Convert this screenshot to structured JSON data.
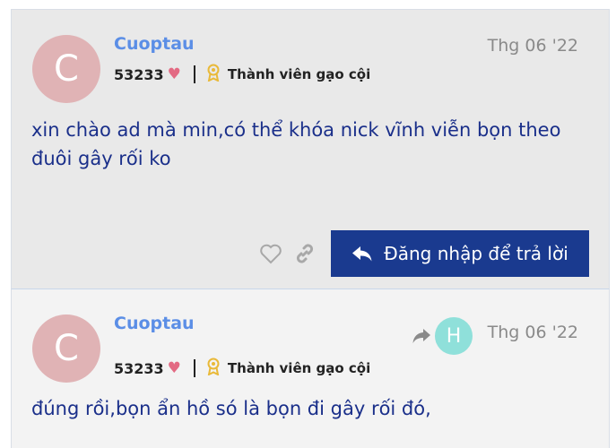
{
  "posts": [
    {
      "avatar_letter": "C",
      "username": "Cuoptau",
      "likes": "53233",
      "user_title": "Thành viên gạo cội",
      "date": "Thg 06 '22",
      "body": "xin chào ad mà min,có thể khóa nick vĩnh viễn bọn theo đuôi gây rối ko",
      "reply_button": "Đăng nhập để trả lời"
    },
    {
      "avatar_letter": "C",
      "username": "Cuoptau",
      "likes": "53233",
      "user_title": "Thành viên gạo cội",
      "date": "Thg 06 '22",
      "reply_to_letter": "H",
      "body": "đúng rồi,bọn ẩn hồ só là bọn đi gây rối đó,"
    }
  ],
  "colors": {
    "accent": "#1a3a8f",
    "username": "#5b8ee6",
    "heart": "#e36a83",
    "badge": "#e9b938",
    "avatar_c": "#e0b3b5",
    "avatar_h": "#8fe0da"
  },
  "icons": [
    "heart-icon",
    "award-icon",
    "like-icon",
    "link-icon",
    "reply-icon",
    "share-reply-icon"
  ]
}
